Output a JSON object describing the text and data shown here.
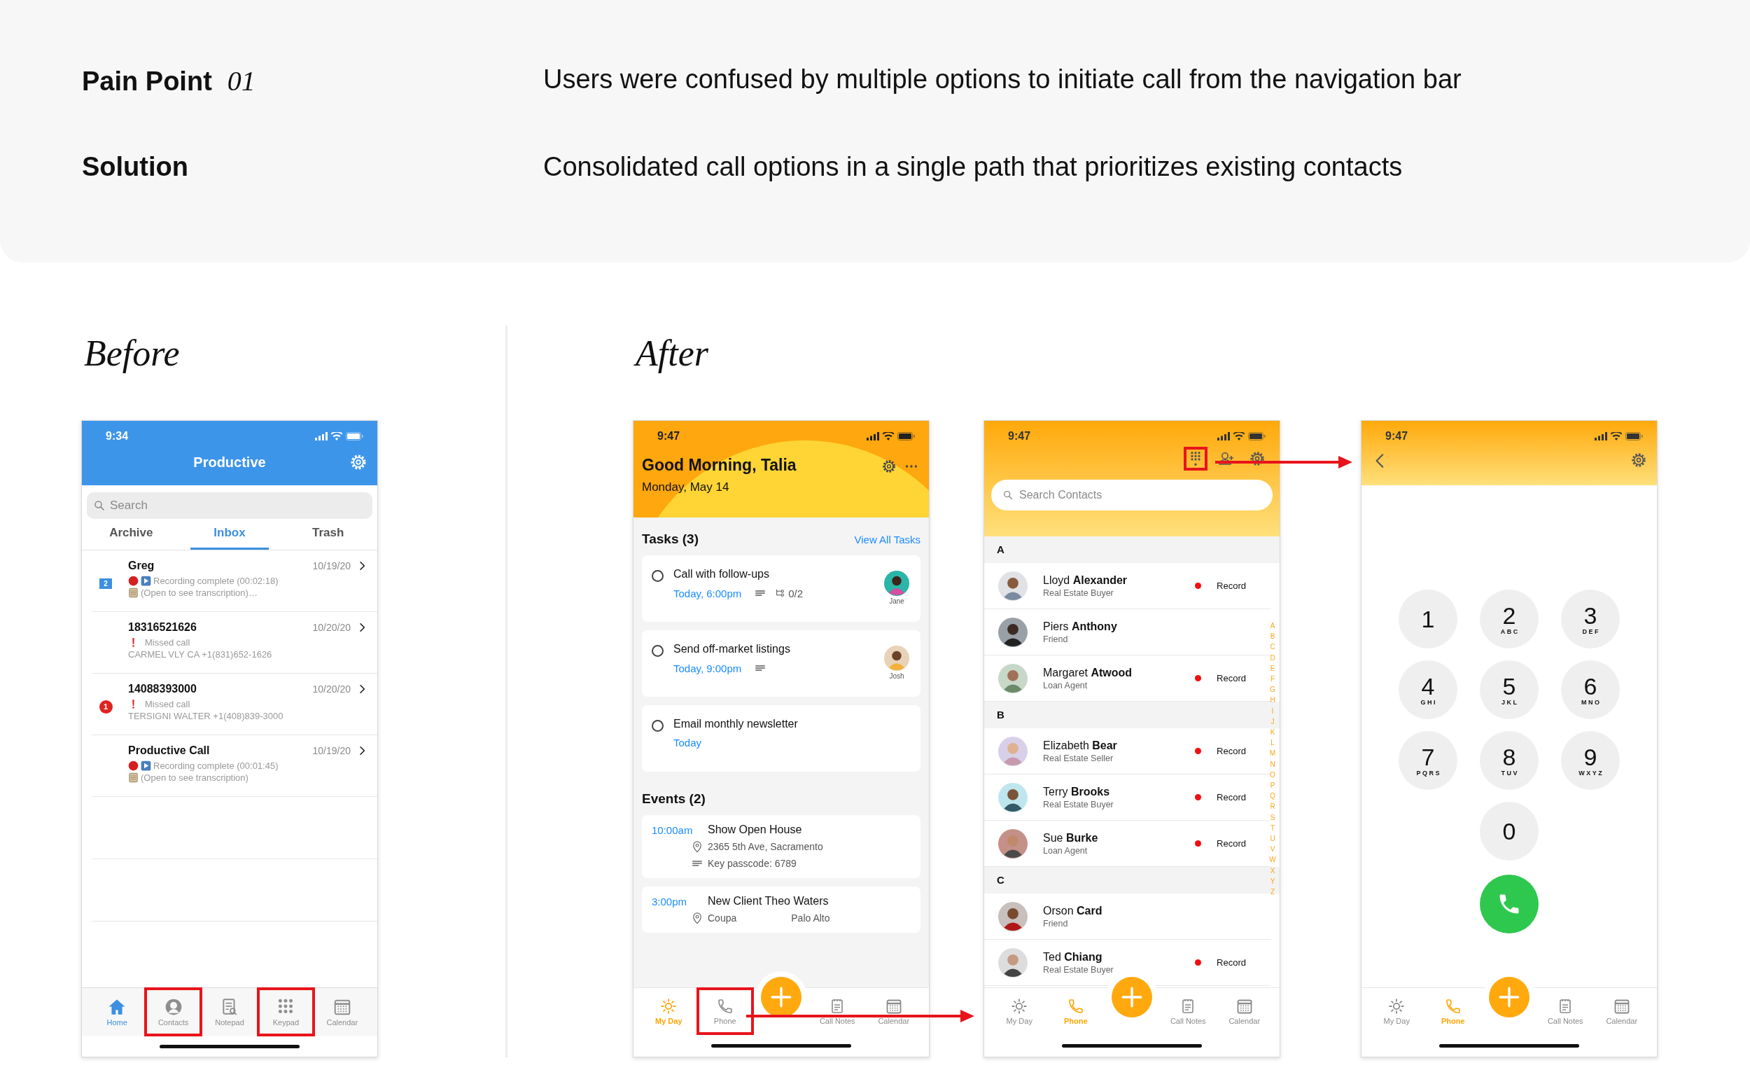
{
  "summary": {
    "rows": [
      {
        "label": "Pain Point",
        "number": "01",
        "text": "Users were confused by multiple options to initiate call from the navigation bar"
      },
      {
        "label": "Solution",
        "text": "Consolidated call options in a single path that prioritizes existing contacts"
      }
    ]
  },
  "before": {
    "title": "Before",
    "phone": {
      "time": "9:34",
      "title": "Productive",
      "search": {
        "placeholder": "Search"
      },
      "tabs": [
        {
          "label": "Archive",
          "selected": false
        },
        {
          "label": "Inbox",
          "selected": true
        },
        {
          "label": "Trash",
          "selected": false
        }
      ],
      "messages": [
        {
          "kind": "recording",
          "title": "Greg",
          "date": "10/19/20",
          "badge": {
            "kind": "square",
            "text": "2"
          },
          "line_1": "Recording complete (00:02:18)",
          "line_2": "(Open to see transcription)…"
        },
        {
          "kind": "missed",
          "title": "18316521626",
          "date": "10/20/20",
          "line_1": "Missed call",
          "line_2": "CARMEL VLY CA +1(831)652-1626"
        },
        {
          "kind": "missed",
          "title": "14088393000",
          "date": "10/20/20",
          "badge": {
            "kind": "circle",
            "text": "1"
          },
          "line_1": "Missed call",
          "line_2": "TERSIGNI WALTER +1(408)839-3000"
        },
        {
          "kind": "recording",
          "title": "Productive Call",
          "date": "10/19/20",
          "line_1": "Recording complete (00:01:45)",
          "line_2": "(Open to see transcription)"
        }
      ],
      "nav": [
        {
          "kind": "home",
          "label": "Home",
          "selected": true,
          "highlighted": false
        },
        {
          "kind": "contacts",
          "label": "Contacts",
          "selected": false,
          "highlighted": true
        },
        {
          "kind": "notepad",
          "label": "Notepad",
          "selected": false,
          "highlighted": false
        },
        {
          "kind": "keypad",
          "label": "Keypad",
          "selected": false,
          "highlighted": true
        },
        {
          "kind": "calendar",
          "label": "Calendar",
          "selected": false,
          "highlighted": false
        }
      ]
    }
  },
  "after": {
    "title": "After",
    "screens": [
      {
        "kind": "my_day",
        "time": "9:47",
        "greeting": "Good Morning, Talia",
        "date": "Monday, May 14",
        "tasks": {
          "title": "Tasks (3)",
          "link": "View All Tasks",
          "items": [
            {
              "title": "Call with follow-ups",
              "due": "Today, 6:00pm",
              "has_note": true,
              "subtasks": "0/2",
              "assignee": "Jane",
              "checked": false
            },
            {
              "title": "Send off-market listings",
              "due": "Today, 9:00pm",
              "has_note": true,
              "assignee": "Josh",
              "checked": false
            },
            {
              "title": "Email monthly newsletter",
              "due": "Today",
              "has_note": false,
              "checked": false
            }
          ]
        },
        "events": {
          "title": "Events (2)",
          "items": [
            {
              "time": "10:00am",
              "title": "Show Open House",
              "location": "2365 5th Ave, Sacramento",
              "note": "Key passcode: 6789"
            },
            {
              "time": "3:00pm",
              "title": "New Client Theo Waters",
              "location_start": "Coupa",
              "location_end": "Palo Alto"
            }
          ]
        },
        "nav": [
          {
            "kind": "my_day",
            "label": "My Day",
            "selected": true,
            "highlighted": false
          },
          {
            "kind": "phone",
            "label": "Phone",
            "selected": false,
            "highlighted": true
          },
          {
            "kind": "call_notes",
            "label": "Call Notes",
            "selected": false,
            "highlighted": false
          },
          {
            "kind": "calendar",
            "label": "Calendar",
            "selected": false,
            "highlighted": false
          }
        ]
      },
      {
        "kind": "contacts",
        "time": "9:47",
        "toolbar": [
          {
            "kind": "keypad",
            "highlighted": true
          },
          {
            "kind": "add_contact",
            "highlighted": false
          },
          {
            "kind": "settings",
            "highlighted": false
          }
        ],
        "search": {
          "placeholder": "Search Contacts"
        },
        "sections": [
          {
            "letter": "A",
            "contacts": [
              {
                "name": "Lloyd **Alexander**",
                "role": "Real Estate Buyer",
                "recording": true,
                "record_label": "Record"
              },
              {
                "name": "Piers **Anthony**",
                "role": "Friend",
                "recording": false
              },
              {
                "name": "Margaret **Atwood**",
                "role": "Loan Agent",
                "recording": true,
                "record_label": "Record"
              }
            ]
          },
          {
            "letter": "B",
            "contacts": [
              {
                "name": "Elizabeth **Bear**",
                "role": "Real Estate Seller",
                "recording": true,
                "record_label": "Record"
              },
              {
                "name": "Terry **Brooks**",
                "role": "Real Estate Buyer",
                "recording": true,
                "record_label": "Record"
              },
              {
                "name": "Sue **Burke**",
                "role": "Loan Agent",
                "recording": true,
                "record_label": "Record"
              }
            ]
          },
          {
            "letter": "C",
            "contacts": [
              {
                "name": "Orson **Card**",
                "role": "Friend",
                "recording": false
              },
              {
                "name": "Ted **Chiang**",
                "role": "Real Estate Buyer",
                "recording": true,
                "record_label": "Record"
              }
            ]
          }
        ],
        "index": [
          "A",
          "B",
          "C",
          "D",
          "E",
          "F",
          "G",
          "H",
          "I",
          "J",
          "K",
          "L",
          "M",
          "N",
          "O",
          "P",
          "Q",
          "R",
          "S",
          "T",
          "U",
          "V",
          "W",
          "X",
          "Y",
          "Z"
        ],
        "nav": [
          {
            "kind": "my_day",
            "label": "My Day",
            "selected": false,
            "highlighted": false
          },
          {
            "kind": "phone",
            "label": "Phone",
            "selected": true,
            "highlighted": false
          },
          {
            "kind": "call_notes",
            "label": "Call Notes",
            "selected": false,
            "highlighted": false
          },
          {
            "kind": "calendar",
            "label": "Calendar",
            "selected": false,
            "highlighted": false
          }
        ]
      },
      {
        "kind": "dialer",
        "time": "9:47",
        "keys": [
          {
            "digit": "1"
          },
          {
            "digit": "2",
            "letters": "ABC"
          },
          {
            "digit": "3",
            "letters": "DEF"
          },
          {
            "digit": "4",
            "letters": "GHI"
          },
          {
            "digit": "5",
            "letters": "JKL"
          },
          {
            "digit": "6",
            "letters": "MNO"
          },
          {
            "digit": "7",
            "letters": "PQRS"
          },
          {
            "digit": "8",
            "letters": "TUV"
          },
          {
            "digit": "9",
            "letters": "WXYZ"
          },
          {
            "digit": "0"
          }
        ],
        "nav": [
          {
            "kind": "my_day",
            "label": "My Day",
            "selected": false,
            "highlighted": false
          },
          {
            "kind": "phone",
            "label": "Phone",
            "selected": true,
            "highlighted": false
          },
          {
            "kind": "call_notes",
            "label": "Call Notes",
            "selected": false,
            "highlighted": false
          },
          {
            "kind": "calendar",
            "label": "Calendar",
            "selected": false,
            "highlighted": false
          }
        ]
      }
    ]
  }
}
